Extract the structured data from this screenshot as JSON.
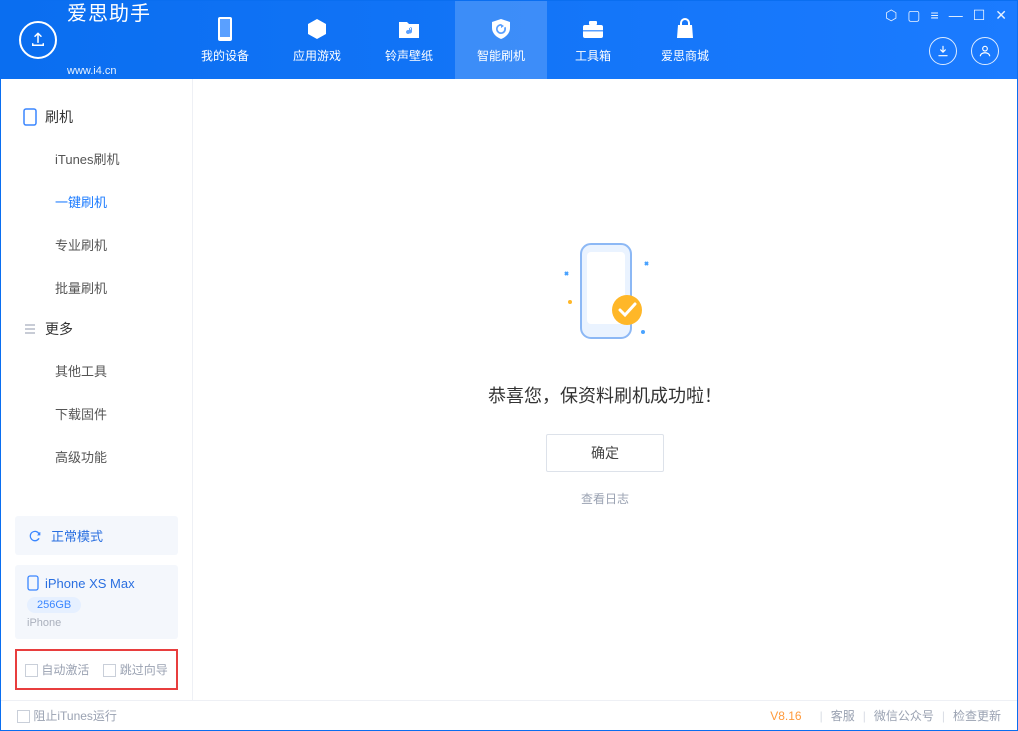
{
  "app": {
    "name": "爱思助手",
    "url": "www.i4.cn"
  },
  "tabs": {
    "device": "我的设备",
    "apps": "应用游戏",
    "ringtone": "铃声壁纸",
    "flash": "智能刷机",
    "toolbox": "工具箱",
    "store": "爱思商城"
  },
  "sidebar": {
    "section_flash": "刷机",
    "items_flash": [
      "iTunes刷机",
      "一键刷机",
      "专业刷机",
      "批量刷机"
    ],
    "section_more": "更多",
    "items_more": [
      "其他工具",
      "下载固件",
      "高级功能"
    ]
  },
  "status": {
    "mode": "正常模式"
  },
  "device": {
    "name": "iPhone XS Max",
    "capacity": "256GB",
    "type": "iPhone"
  },
  "checkboxes": {
    "auto_activate": "自动激活",
    "skip_guide": "跳过向导"
  },
  "main": {
    "success_text": "恭喜您，保资料刷机成功啦！",
    "ok_button": "确定",
    "view_log": "查看日志"
  },
  "footer": {
    "block_itunes": "阻止iTunes运行",
    "version": "V8.16",
    "support": "客服",
    "wechat": "微信公众号",
    "update": "检查更新"
  }
}
